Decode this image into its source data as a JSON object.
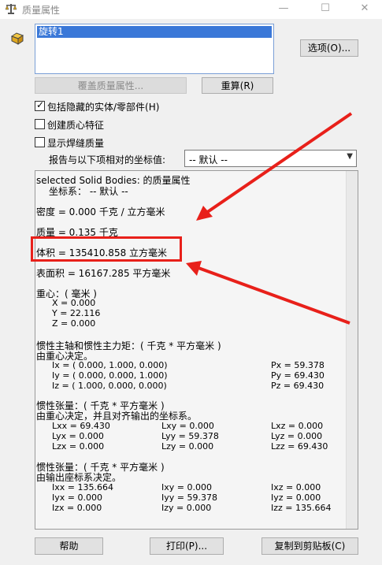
{
  "window": {
    "title": "质量属性",
    "minimize_glyph": "—",
    "maximize_glyph": "☐",
    "close_glyph": "✕"
  },
  "selection": {
    "items": [
      "旋转1"
    ]
  },
  "buttons": {
    "options": "选项(O)...",
    "override": "覆盖质量属性...",
    "recalculate": "重算(R)",
    "help": "帮助",
    "print": "打印(P)...",
    "copy": "复制到剪贴板(C)"
  },
  "checkboxes": [
    {
      "label": "包括隐藏的实体/零部件(H)",
      "checked": true
    },
    {
      "label": "创建质心特征",
      "checked": false
    },
    {
      "label": "显示焊缝质量",
      "checked": false
    }
  ],
  "report": {
    "label": "报告与以下项相对的坐标值:",
    "value": "-- 默认 --"
  },
  "results": {
    "header1": "selected Solid Bodies: 的质量属性",
    "header2": "坐标系：  -- 默认 --",
    "density": "密度 = 0.000 千克 / 立方毫米",
    "mass": "质量 = 0.135 千克",
    "volume": "体积 = 135410.858 立方毫米",
    "surface": "表面积 = 16167.285  平方毫米",
    "com_title": "重心：( 毫米 )",
    "com_x": "X = 0.000",
    "com_y": "Y = 22.116",
    "com_z": "Z = 0.000",
    "pa_title": "惯性主轴和惯性主力矩：( 千克 *  平方毫米 )",
    "pa_sub": "由重心决定。",
    "ix": "Ix = ( 0.000,  1.000,  0.000)",
    "iy": "Iy = ( 0.000,  0.000,  1.000)",
    "iz": "Iz = ( 1.000,  0.000,  0.000)",
    "px": "Px = 59.378",
    "py": "Py = 69.430",
    "pz": "Pz = 69.430",
    "it1_title": "惯性张量：( 千克 *  平方毫米 )",
    "it1_sub": "由重心决定，并且对齐输出的坐标系。",
    "t1": [
      [
        "Lxx = 69.430",
        "Lxy = 0.000",
        "Lxz = 0.000"
      ],
      [
        "Lyx = 0.000",
        "Lyy = 59.378",
        "Lyz = 0.000"
      ],
      [
        "Lzx = 0.000",
        "Lzy = 0.000",
        "Lzz = 69.430"
      ]
    ],
    "it2_title": "惯性张量：( 千克 *  平方毫米 )",
    "it2_sub": "由输出座标系决定。",
    "t2": [
      [
        "Ixx = 135.664",
        "Ixy = 0.000",
        "Ixz = 0.000"
      ],
      [
        "Iyx = 0.000",
        "Iyy = 59.378",
        "Iyz = 0.000"
      ],
      [
        "Izx = 0.000",
        "Izy = 0.000",
        "Izz = 135.664"
      ]
    ]
  },
  "annotation_color": "#e8201a"
}
